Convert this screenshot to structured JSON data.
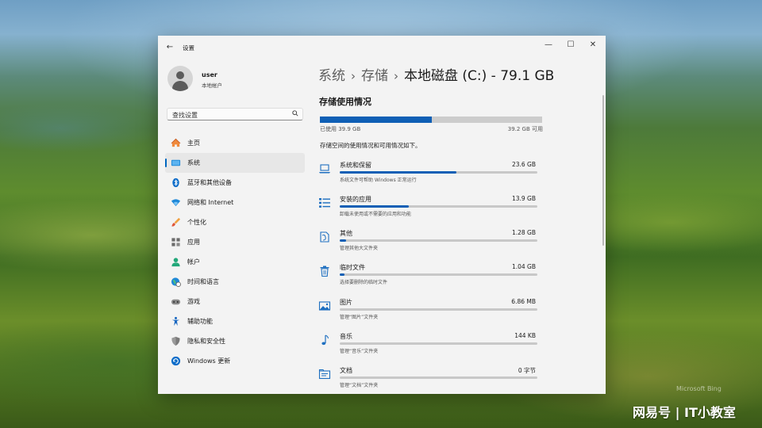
{
  "window": {
    "title": "设置",
    "controls": {
      "minimize": "—",
      "maximize": "☐",
      "close": "✕"
    }
  },
  "profile": {
    "name": "user",
    "subtitle": "本地帐户"
  },
  "search": {
    "placeholder": "查找设置"
  },
  "nav": {
    "items": [
      {
        "label": "主页",
        "icon": "home-icon"
      },
      {
        "label": "系统",
        "icon": "system-icon",
        "active": true
      },
      {
        "label": "蓝牙和其他设备",
        "icon": "bluetooth-icon"
      },
      {
        "label": "网络和 Internet",
        "icon": "wifi-icon"
      },
      {
        "label": "个性化",
        "icon": "brush-icon"
      },
      {
        "label": "应用",
        "icon": "apps-icon"
      },
      {
        "label": "帐户",
        "icon": "account-icon"
      },
      {
        "label": "时间和语言",
        "icon": "globe-clock-icon"
      },
      {
        "label": "游戏",
        "icon": "gamepad-icon"
      },
      {
        "label": "辅助功能",
        "icon": "accessibility-icon"
      },
      {
        "label": "隐私和安全性",
        "icon": "shield-icon"
      },
      {
        "label": "Windows 更新",
        "icon": "update-icon"
      }
    ]
  },
  "breadcrumb": {
    "part1": "系统",
    "part2": "存储",
    "current": "本地磁盘 (C:) - 79.1 GB",
    "separator": "›"
  },
  "storage": {
    "title": "存储使用情况",
    "used_fraction": 0.505,
    "used_label": "已使用 39.9 GB",
    "free_label": "39.2 GB 可用",
    "description": "存储空间的使用情况和可用情况如下。",
    "categories": [
      {
        "name": "系统和保留",
        "size": "23.6 GB",
        "sub": "系统文件可帮助 Windows 正常运行",
        "fraction": 0.59,
        "icon": "laptop-icon"
      },
      {
        "name": "安装的应用",
        "size": "13.9 GB",
        "sub": "卸载未使用或不需要的应用和功能",
        "fraction": 0.35,
        "icon": "list-icon"
      },
      {
        "name": "其他",
        "size": "1.28 GB",
        "sub": "管理其他大文件夹",
        "fraction": 0.032,
        "icon": "other-file-icon"
      },
      {
        "name": "临时文件",
        "size": "1.04 GB",
        "sub": "选择要删除的临时文件",
        "fraction": 0.026,
        "icon": "trash-icon"
      },
      {
        "name": "图片",
        "size": "6.86 MB",
        "sub": "管理“图片”文件夹",
        "fraction": 0.0,
        "icon": "picture-icon"
      },
      {
        "name": "音乐",
        "size": "144 KB",
        "sub": "管理“音乐”文件夹",
        "fraction": 0.0,
        "icon": "music-icon"
      },
      {
        "name": "文档",
        "size": "0 字节",
        "sub": "管理“文档”文件夹",
        "fraction": 0.0,
        "icon": "document-icon"
      }
    ]
  },
  "watermark": {
    "bing": "Microsoft Bing",
    "source": "网易号 | IT小教室"
  },
  "colors": {
    "accent": "#0f5fb5",
    "track": "#cccccc",
    "window_bg": "#f3f3f3"
  }
}
